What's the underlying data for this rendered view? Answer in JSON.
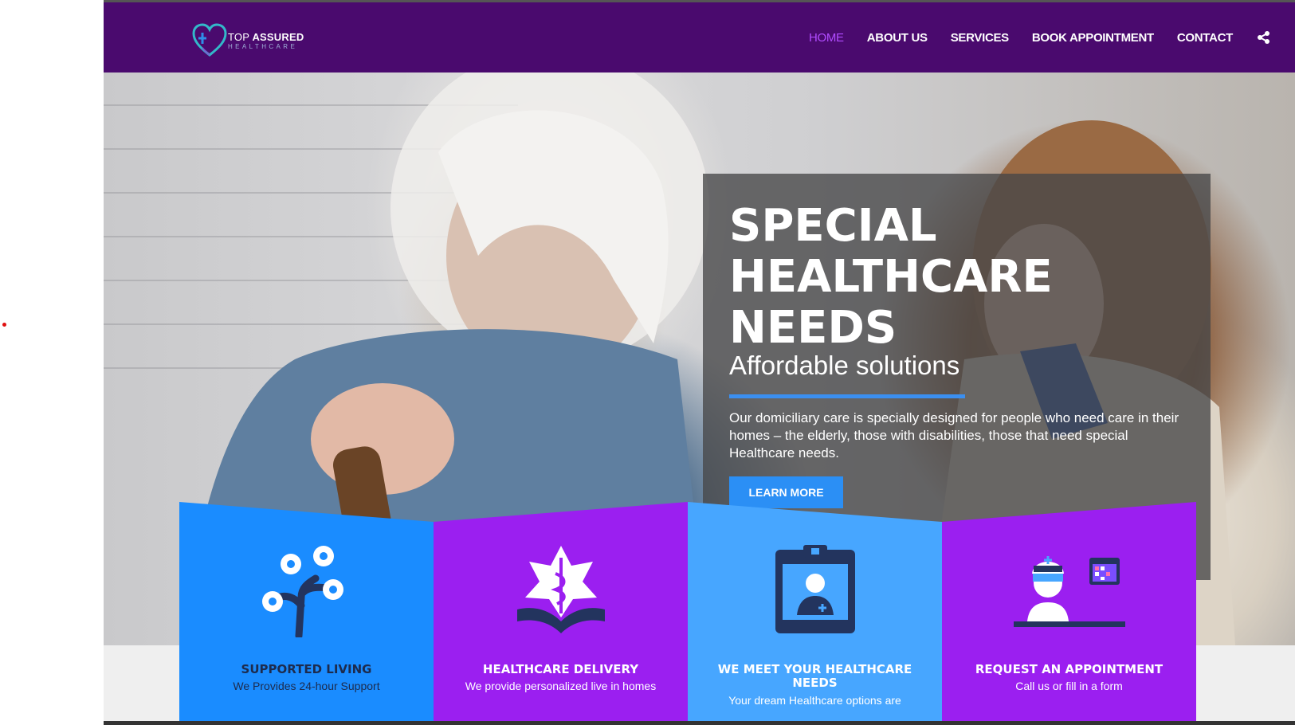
{
  "brand": {
    "name_top_thin": "TOP",
    "name_top_bold": "ASSURED",
    "name_sub": "HEALTHCARE"
  },
  "nav": {
    "items": [
      {
        "label": "HOME",
        "active": true
      },
      {
        "label": "ABOUT US"
      },
      {
        "label": "SERVICES"
      },
      {
        "label": "BOOK APPOINTMENT"
      },
      {
        "label": "CONTACT"
      }
    ],
    "share_icon": "share-icon"
  },
  "hero": {
    "headline_line1": "SPECIAL",
    "headline_line2": "HEALTHCARE",
    "headline_line3": "NEEDS",
    "tagline": "Affordable solutions",
    "description": "Our domiciliary care is specially designed for people who need care in their homes – the elderly, those with disabilities, those that need special Healthcare needs.",
    "cta_label": "LEARN MORE"
  },
  "cards": [
    {
      "title": "SUPPORTED LIVING",
      "subtitle": "We Provides 24-hour Support",
      "icon": "tree-icon",
      "color": "#1a8cff"
    },
    {
      "title": "HEALTHCARE DELIVERY",
      "subtitle": "We provide personalized live in homes",
      "icon": "medical-book-icon",
      "color": "#9b1ff0"
    },
    {
      "title": "WE MEET YOUR HEALTHCARE NEEDS",
      "subtitle": "Your dream Healthcare options are",
      "icon": "doctor-badge-icon",
      "color": "#47a6ff"
    },
    {
      "title": "REQUEST AN APPOINTMENT",
      "subtitle": "Call us or fill in a form",
      "icon": "nurse-calendar-icon",
      "color": "#9b1ff0"
    }
  ],
  "colors": {
    "header": "#4a0a6e",
    "nav_active": "#b14cff",
    "accent_blue": "#2b8ff5",
    "card_title_dark": "#1d2b4d"
  }
}
